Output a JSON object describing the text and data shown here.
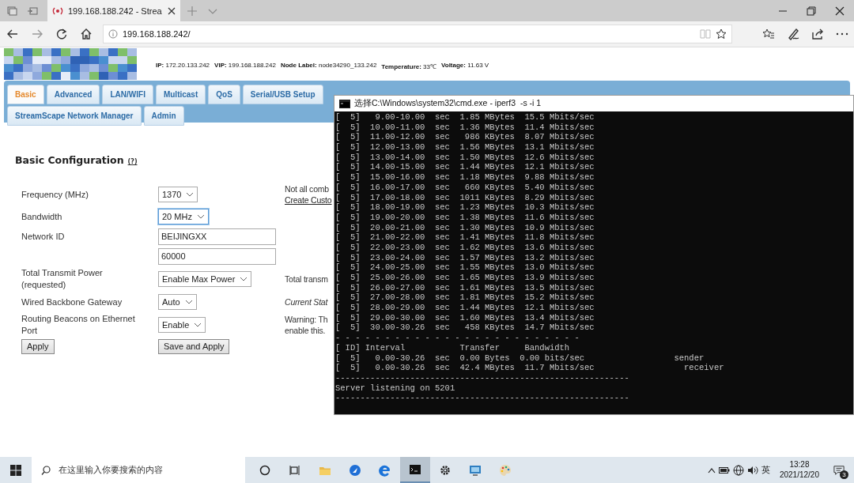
{
  "browser": {
    "tab_title": "199.168.188.242 - Strea",
    "address": "199.168.188.242/"
  },
  "header": {
    "info": [
      {
        "label": "IP:",
        "value": "172.20.133.242"
      },
      {
        "label": "VIP:",
        "value": "199.168.188.242"
      },
      {
        "label": "Node Label:",
        "value": "node34290_133.242"
      },
      {
        "label": "Temperature:",
        "value": "33℃"
      },
      {
        "label": "Voltage:",
        "value": "11.63 V"
      }
    ]
  },
  "nav_tab_rows": [
    {
      "tabs": [
        {
          "label": "Basic",
          "selected": true
        },
        {
          "label": "Advanced",
          "selected": false
        },
        {
          "label": "LAN/WIFI",
          "selected": false
        },
        {
          "label": "Multicast",
          "selected": false
        },
        {
          "label": "QoS",
          "selected": false
        },
        {
          "label": "Serial/USB Setup",
          "selected": false
        }
      ]
    },
    {
      "tabs": [
        {
          "label": "StreamScape Network Manager",
          "selected": false
        },
        {
          "label": "Admin",
          "selected": false
        }
      ]
    }
  ],
  "section": {
    "title": "Basic Configuration",
    "help": "(?)"
  },
  "fields": [
    {
      "label": "Frequency (MHz)",
      "kind": "select",
      "value": "1370",
      "focused": false,
      "notes": [
        {
          "kind": "plain",
          "text": "Not all comb"
        },
        {
          "kind": "link",
          "text": "Create Custo"
        }
      ]
    },
    {
      "label": "Bandwidth",
      "kind": "select",
      "value": "20 MHz",
      "focused": true
    },
    {
      "label": "Network ID",
      "kind": "text",
      "value": "BEIJINGXX",
      "focused": false
    },
    {
      "kind": "text",
      "value": "60000",
      "focused": false
    },
    {
      "label": "Total Transmit Power (requested)",
      "kind": "select",
      "value": "Enable Max Power",
      "focused": false,
      "notes": [
        {
          "kind": "plain",
          "text": "Total transm"
        }
      ]
    },
    {
      "label": "Wired Backbone Gateway",
      "kind": "select",
      "value": "Auto",
      "focused": false,
      "notes": [
        {
          "kind": "italic",
          "text": "Current Stat"
        }
      ]
    },
    {
      "label": "Routing Beacons on Ethernet Port",
      "kind": "select",
      "value": "Enable",
      "focused": false,
      "notes": [
        {
          "kind": "plain",
          "text": "Warning: Th"
        },
        {
          "kind": "plain",
          "text": "enable this."
        }
      ]
    }
  ],
  "buttons": [
    "Apply",
    "Save and Apply"
  ],
  "cmd": {
    "title": "选择C:\\Windows\\system32\\cmd.exe - iperf3  -s -i 1",
    "lines": [
      "[  5]   9.00-10.00  sec  1.85 MBytes  15.5 Mbits/sec",
      "[  5]  10.00-11.00  sec  1.36 MBytes  11.4 Mbits/sec",
      "[  5]  11.00-12.00  sec   986 KBytes  8.07 Mbits/sec",
      "[  5]  12.00-13.00  sec  1.56 MBytes  13.1 Mbits/sec",
      "[  5]  13.00-14.00  sec  1.50 MBytes  12.6 Mbits/sec",
      "[  5]  14.00-15.00  sec  1.44 MBytes  12.1 Mbits/sec",
      "[  5]  15.00-16.00  sec  1.18 MBytes  9.88 Mbits/sec",
      "[  5]  16.00-17.00  sec   660 KBytes  5.40 Mbits/sec",
      "[  5]  17.00-18.00  sec  1011 KBytes  8.29 Mbits/sec",
      "[  5]  18.00-19.00  sec  1.23 MBytes  10.3 Mbits/sec",
      "[  5]  19.00-20.00  sec  1.38 MBytes  11.6 Mbits/sec",
      "[  5]  20.00-21.00  sec  1.30 MBytes  10.9 Mbits/sec",
      "[  5]  21.00-22.00  sec  1.41 MBytes  11.8 Mbits/sec",
      "[  5]  22.00-23.00  sec  1.62 MBytes  13.6 Mbits/sec",
      "[  5]  23.00-24.00  sec  1.57 MBytes  13.2 Mbits/sec",
      "[  5]  24.00-25.00  sec  1.55 MBytes  13.0 Mbits/sec",
      "[  5]  25.00-26.00  sec  1.65 MBytes  13.9 Mbits/sec",
      "[  5]  26.00-27.00  sec  1.61 MBytes  13.5 Mbits/sec",
      "[  5]  27.00-28.00  sec  1.81 MBytes  15.2 Mbits/sec",
      "[  5]  28.00-29.00  sec  1.44 MBytes  12.1 Mbits/sec",
      "[  5]  29.00-30.00  sec  1.60 MBytes  13.4 Mbits/sec",
      "[  5]  30.00-30.26  sec   458 KBytes  14.7 Mbits/sec",
      "- - - - - - - - - - - - - - - - - - - - - - - - -",
      "[ ID] Interval           Transfer     Bandwidth",
      "[  5]   0.00-30.26  sec  0.00 Bytes  0.00 bits/sec                  sender",
      "[  5]   0.00-30.26  sec  42.4 MBytes  11.7 Mbits/sec                  receiver",
      "-----------------------------------------------------------",
      "Server listening on 5201",
      "-----------------------------------------------------------"
    ]
  },
  "taskbar": {
    "search_placeholder": "在这里输入你要搜索的内容",
    "apps": [
      {
        "kind": "cortana",
        "active": false
      },
      {
        "kind": "taskview",
        "active": false
      },
      {
        "kind": "folder",
        "active": false
      },
      {
        "kind": "bluebird",
        "active": false
      },
      {
        "kind": "edge",
        "active": false
      },
      {
        "kind": "terminal",
        "active": true
      },
      {
        "kind": "gear",
        "active": false
      },
      {
        "kind": "monitor",
        "active": false
      },
      {
        "kind": "palette",
        "active": false
      }
    ],
    "ime": "英",
    "time": "13:28",
    "date": "2021/12/20",
    "notifications": "3"
  }
}
